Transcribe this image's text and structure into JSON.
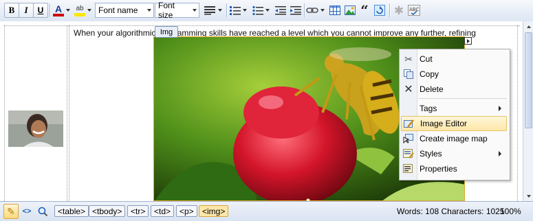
{
  "toolbar": {
    "bold_label": "B",
    "italic_label": "I",
    "underline_label": "U",
    "font_color_label": "A",
    "highlight_label": "ab",
    "font_name": "Font name",
    "font_size": "Font size",
    "accent_color": "#cc0000",
    "highlight_color": "#ffe600"
  },
  "content": {
    "paragraph": "When your algorithmic programming skills have reached a level which you cannot improve any further, refining",
    "img_tag_label": "Img"
  },
  "context_menu": {
    "items": [
      {
        "label": "Cut",
        "icon": "scissors-icon"
      },
      {
        "label": "Copy",
        "icon": "copy-icon"
      },
      {
        "label": "Delete",
        "icon": "delete-icon"
      },
      {
        "label": "Tags",
        "icon": "none"
      },
      {
        "label": "Image Editor",
        "icon": "image-editor-icon"
      },
      {
        "label": "Create image map",
        "icon": "image-map-icon"
      },
      {
        "label": "Styles",
        "icon": "styles-icon"
      },
      {
        "label": "Properties",
        "icon": "properties-icon"
      }
    ],
    "highlighted_index": 4
  },
  "status_bar": {
    "tags": [
      "<table>",
      "<tbody>",
      "<tr>",
      "<td>",
      "<p>",
      "<img>"
    ],
    "active_tag_index": 5,
    "word_count": "Words: 108 Characters: 1025",
    "zoom": "100%"
  }
}
